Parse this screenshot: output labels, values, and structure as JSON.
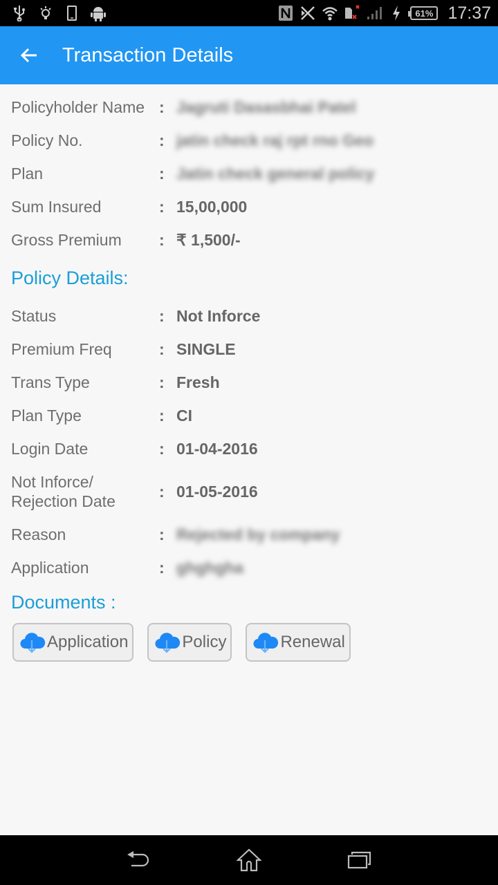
{
  "status_bar": {
    "left_icons": [
      "usb-icon",
      "lightbulb-icon",
      "phone-icon",
      "android-icon"
    ],
    "right_icons": [
      "nfc-icon",
      "bluetooth-off-icon",
      "wifi-icon",
      "sim-error-icon",
      "signal-icon",
      "charging-icon"
    ],
    "battery": "61%",
    "time": "17:37"
  },
  "app_bar": {
    "back_icon": "arrow-left-icon",
    "title": "Transaction Details"
  },
  "summary": [
    {
      "label": "Policyholder Name",
      "value": "Jagruti Dasasbhai Patel",
      "redacted": true
    },
    {
      "label": "Policy No.",
      "value": "jatin check raj rpt rno Geo",
      "redacted": true
    },
    {
      "label": "Plan",
      "value": "Jatin check general policy",
      "redacted": true
    },
    {
      "label": "Sum Insured",
      "value": "15,00,000",
      "redacted": false
    },
    {
      "label": "Gross Premium",
      "value": "₹ 1,500/-",
      "redacted": false
    }
  ],
  "policy_details": {
    "heading": "Policy Details:",
    "rows": [
      {
        "label": "Status",
        "value": "Not Inforce",
        "redacted": false
      },
      {
        "label": "Premium Freq",
        "value": "SINGLE",
        "redacted": false
      },
      {
        "label": "Trans Type",
        "value": "Fresh",
        "redacted": false
      },
      {
        "label": "Plan Type",
        "value": "CI",
        "redacted": false
      },
      {
        "label": "Login Date",
        "value": "01-04-2016",
        "redacted": false
      },
      {
        "label": "Not Inforce/ Rejection Date",
        "value": "01-05-2016",
        "redacted": false
      },
      {
        "label": "Reason",
        "value": "Rejected by company",
        "redacted": true
      },
      {
        "label": "Application",
        "value": "ghghgha",
        "redacted": true
      }
    ]
  },
  "documents": {
    "heading": "Documents :",
    "buttons": [
      {
        "label": "Application",
        "icon": "cloud-download-icon"
      },
      {
        "label": "Policy",
        "icon": "cloud-download-icon"
      },
      {
        "label": "Renewal",
        "icon": "cloud-download-icon"
      }
    ]
  },
  "colon": ":",
  "colors": {
    "app_bar": "#2196f3",
    "section_heading": "#1a9ed8",
    "cloud_icon": "#1e88f5"
  },
  "nav_bar": {
    "icons": [
      "back-icon",
      "home-icon",
      "recents-icon"
    ]
  }
}
